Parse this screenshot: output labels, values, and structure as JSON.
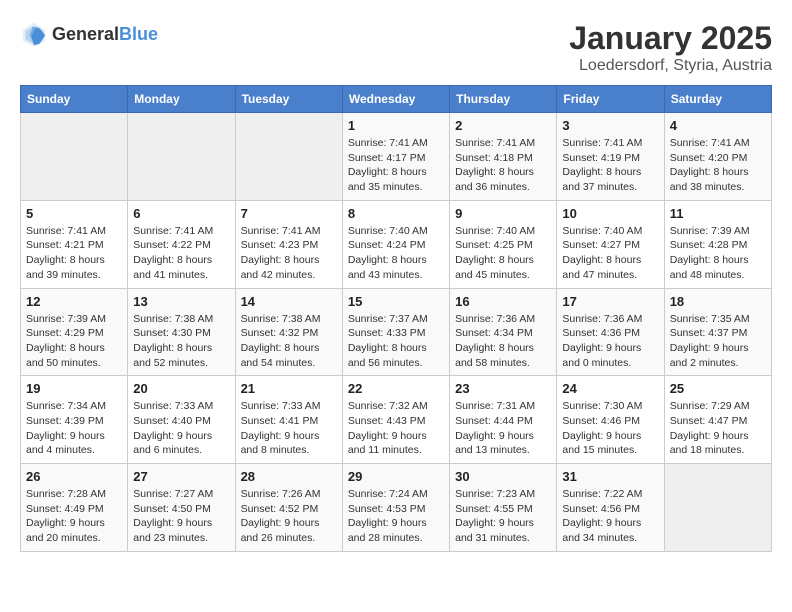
{
  "logo": {
    "text_general": "General",
    "text_blue": "Blue"
  },
  "title": "January 2025",
  "subtitle": "Loedersdorf, Styria, Austria",
  "headers": [
    "Sunday",
    "Monday",
    "Tuesday",
    "Wednesday",
    "Thursday",
    "Friday",
    "Saturday"
  ],
  "weeks": [
    [
      {
        "day": "",
        "info": ""
      },
      {
        "day": "",
        "info": ""
      },
      {
        "day": "",
        "info": ""
      },
      {
        "day": "1",
        "info": "Sunrise: 7:41 AM\nSunset: 4:17 PM\nDaylight: 8 hours\nand 35 minutes."
      },
      {
        "day": "2",
        "info": "Sunrise: 7:41 AM\nSunset: 4:18 PM\nDaylight: 8 hours\nand 36 minutes."
      },
      {
        "day": "3",
        "info": "Sunrise: 7:41 AM\nSunset: 4:19 PM\nDaylight: 8 hours\nand 37 minutes."
      },
      {
        "day": "4",
        "info": "Sunrise: 7:41 AM\nSunset: 4:20 PM\nDaylight: 8 hours\nand 38 minutes."
      }
    ],
    [
      {
        "day": "5",
        "info": "Sunrise: 7:41 AM\nSunset: 4:21 PM\nDaylight: 8 hours\nand 39 minutes."
      },
      {
        "day": "6",
        "info": "Sunrise: 7:41 AM\nSunset: 4:22 PM\nDaylight: 8 hours\nand 41 minutes."
      },
      {
        "day": "7",
        "info": "Sunrise: 7:41 AM\nSunset: 4:23 PM\nDaylight: 8 hours\nand 42 minutes."
      },
      {
        "day": "8",
        "info": "Sunrise: 7:40 AM\nSunset: 4:24 PM\nDaylight: 8 hours\nand 43 minutes."
      },
      {
        "day": "9",
        "info": "Sunrise: 7:40 AM\nSunset: 4:25 PM\nDaylight: 8 hours\nand 45 minutes."
      },
      {
        "day": "10",
        "info": "Sunrise: 7:40 AM\nSunset: 4:27 PM\nDaylight: 8 hours\nand 47 minutes."
      },
      {
        "day": "11",
        "info": "Sunrise: 7:39 AM\nSunset: 4:28 PM\nDaylight: 8 hours\nand 48 minutes."
      }
    ],
    [
      {
        "day": "12",
        "info": "Sunrise: 7:39 AM\nSunset: 4:29 PM\nDaylight: 8 hours\nand 50 minutes."
      },
      {
        "day": "13",
        "info": "Sunrise: 7:38 AM\nSunset: 4:30 PM\nDaylight: 8 hours\nand 52 minutes."
      },
      {
        "day": "14",
        "info": "Sunrise: 7:38 AM\nSunset: 4:32 PM\nDaylight: 8 hours\nand 54 minutes."
      },
      {
        "day": "15",
        "info": "Sunrise: 7:37 AM\nSunset: 4:33 PM\nDaylight: 8 hours\nand 56 minutes."
      },
      {
        "day": "16",
        "info": "Sunrise: 7:36 AM\nSunset: 4:34 PM\nDaylight: 8 hours\nand 58 minutes."
      },
      {
        "day": "17",
        "info": "Sunrise: 7:36 AM\nSunset: 4:36 PM\nDaylight: 9 hours\nand 0 minutes."
      },
      {
        "day": "18",
        "info": "Sunrise: 7:35 AM\nSunset: 4:37 PM\nDaylight: 9 hours\nand 2 minutes."
      }
    ],
    [
      {
        "day": "19",
        "info": "Sunrise: 7:34 AM\nSunset: 4:39 PM\nDaylight: 9 hours\nand 4 minutes."
      },
      {
        "day": "20",
        "info": "Sunrise: 7:33 AM\nSunset: 4:40 PM\nDaylight: 9 hours\nand 6 minutes."
      },
      {
        "day": "21",
        "info": "Sunrise: 7:33 AM\nSunset: 4:41 PM\nDaylight: 9 hours\nand 8 minutes."
      },
      {
        "day": "22",
        "info": "Sunrise: 7:32 AM\nSunset: 4:43 PM\nDaylight: 9 hours\nand 11 minutes."
      },
      {
        "day": "23",
        "info": "Sunrise: 7:31 AM\nSunset: 4:44 PM\nDaylight: 9 hours\nand 13 minutes."
      },
      {
        "day": "24",
        "info": "Sunrise: 7:30 AM\nSunset: 4:46 PM\nDaylight: 9 hours\nand 15 minutes."
      },
      {
        "day": "25",
        "info": "Sunrise: 7:29 AM\nSunset: 4:47 PM\nDaylight: 9 hours\nand 18 minutes."
      }
    ],
    [
      {
        "day": "26",
        "info": "Sunrise: 7:28 AM\nSunset: 4:49 PM\nDaylight: 9 hours\nand 20 minutes."
      },
      {
        "day": "27",
        "info": "Sunrise: 7:27 AM\nSunset: 4:50 PM\nDaylight: 9 hours\nand 23 minutes."
      },
      {
        "day": "28",
        "info": "Sunrise: 7:26 AM\nSunset: 4:52 PM\nDaylight: 9 hours\nand 26 minutes."
      },
      {
        "day": "29",
        "info": "Sunrise: 7:24 AM\nSunset: 4:53 PM\nDaylight: 9 hours\nand 28 minutes."
      },
      {
        "day": "30",
        "info": "Sunrise: 7:23 AM\nSunset: 4:55 PM\nDaylight: 9 hours\nand 31 minutes."
      },
      {
        "day": "31",
        "info": "Sunrise: 7:22 AM\nSunset: 4:56 PM\nDaylight: 9 hours\nand 34 minutes."
      },
      {
        "day": "",
        "info": ""
      }
    ]
  ]
}
